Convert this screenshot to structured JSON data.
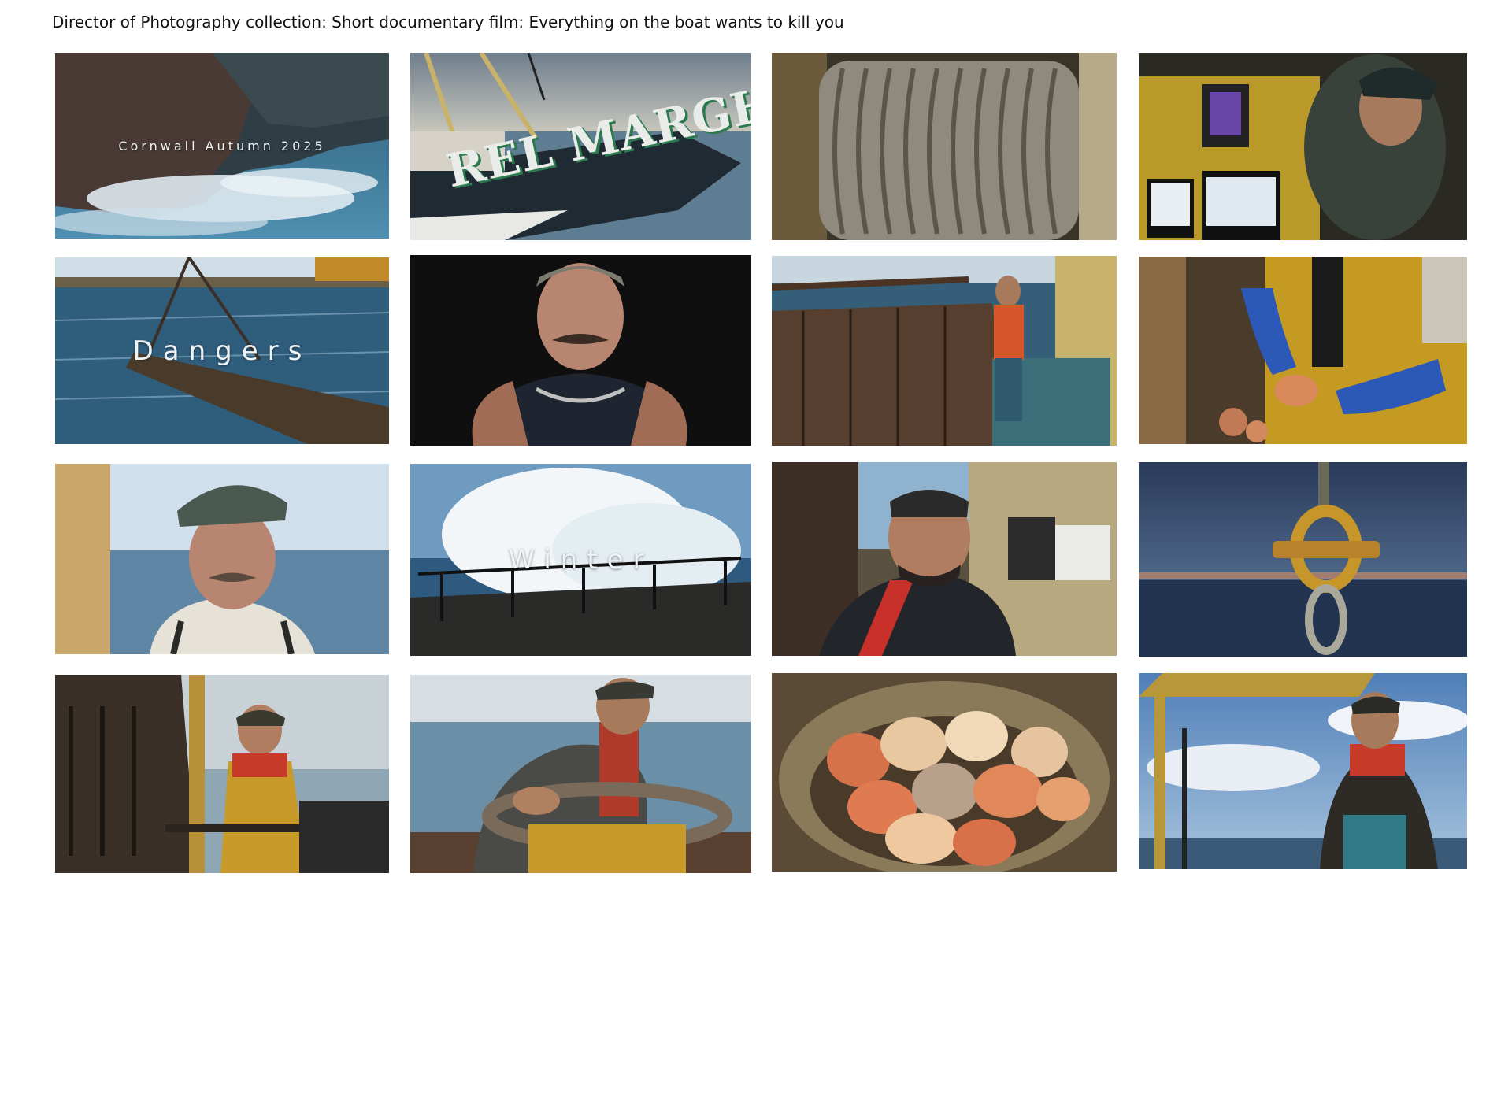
{
  "page": {
    "caption": "Director of Photography collection:  Short documentary film:  Everything on the boat wants to kill you"
  },
  "gallery": {
    "tiles": [
      {
        "id": "cliffs-waves",
        "subject": "sea crashing against dark cliffs",
        "overlay_text": "Cornwall Autumn 2025"
      },
      {
        "id": "boat-bow",
        "subject": "bow of fishing boat at sea",
        "visible_text": "REL MARGH"
      },
      {
        "id": "cable-drum",
        "subject": "coiled steel cable on winch drum"
      },
      {
        "id": "wheelhouse",
        "subject": "fisherman at wheelhouse navigation screens"
      },
      {
        "id": "dredges-sea",
        "subject": "dredge gear hauled through rough sea",
        "overlay_text": "Dangers"
      },
      {
        "id": "portrait-dark",
        "subject": "portrait of moustached fisherman on black background"
      },
      {
        "id": "deck-hauling",
        "subject": "fisherman in orange lifejacket on deck with chains"
      },
      {
        "id": "gloved-scallops",
        "subject": "gloved hands holding scallop knife and shell"
      },
      {
        "id": "portrait-cap",
        "subject": "fisherman in cap at sea"
      },
      {
        "id": "winter-wave",
        "subject": "wave breaking over harbour railing",
        "overlay_text": "Winter"
      },
      {
        "id": "fisherman-looking-up",
        "subject": "bearded fisherman looking up on deck"
      },
      {
        "id": "shackle",
        "subject": "rusty shackle hanging against dusk sky"
      },
      {
        "id": "dredge-lever",
        "subject": "smiling fisherman pulling dredge lever"
      },
      {
        "id": "hand-wheel",
        "subject": "fisherman holding metal wheel"
      },
      {
        "id": "scallop-basket",
        "subject": "basket full of scallops"
      },
      {
        "id": "fisherman-horizon",
        "subject": "fisherman gazing over sea under clouds"
      }
    ]
  },
  "colors": {
    "background": "#ffffff",
    "caption_text": "#111111",
    "overlay_text": "#eef3f6"
  }
}
